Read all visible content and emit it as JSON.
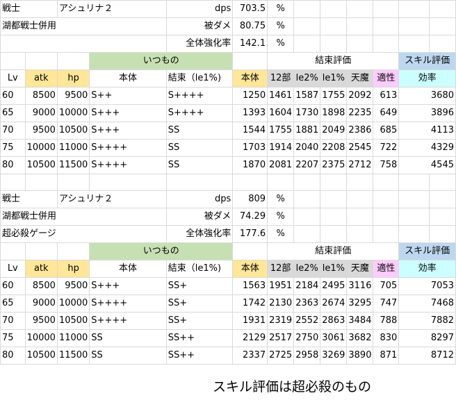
{
  "sections": [
    {
      "info": [
        {
          "a": "戦士",
          "b": "アシュリナ２",
          "label": "dps",
          "value": "703.5",
          "unit": "%"
        },
        {
          "a": "湖都戦士併用",
          "b": "",
          "label": "被ダメ",
          "value": "80.75",
          "unit": "%"
        },
        {
          "a": "",
          "b": "",
          "label": "全体強化率",
          "value": "142.1",
          "unit": "%"
        }
      ],
      "groups": {
        "itsumono": "いつもの",
        "kessoku": "結束評価",
        "skill": "スキル評価"
      },
      "headers": [
        "Lv",
        "atk",
        "hp",
        "本体",
        "結束（le1%)",
        "本体",
        "12部",
        "le2%",
        "le1%",
        "天魔",
        "適性",
        "効率"
      ],
      "rows": [
        [
          "60",
          "8500",
          "9500",
          "S++",
          "S++++",
          "1250",
          "1461",
          "1587",
          "1755",
          "2092",
          "613",
          "3680"
        ],
        [
          "65",
          "9000",
          "10000",
          "S+++",
          "S++++",
          "1393",
          "1604",
          "1730",
          "1898",
          "2235",
          "649",
          "3896"
        ],
        [
          "70",
          "9500",
          "10500",
          "S+++",
          "SS",
          "1544",
          "1755",
          "1881",
          "2049",
          "2386",
          "685",
          "4113"
        ],
        [
          "75",
          "10000",
          "11000",
          "S++++",
          "SS",
          "1703",
          "1914",
          "2040",
          "2208",
          "2545",
          "722",
          "4329"
        ],
        [
          "80",
          "10500",
          "11500",
          "S++++",
          "SS",
          "1870",
          "2081",
          "2207",
          "2375",
          "2712",
          "758",
          "4545"
        ]
      ]
    },
    {
      "info": [
        {
          "a": "戦士",
          "b": "アシュリナ２",
          "label": "dps",
          "value": "809",
          "unit": "%"
        },
        {
          "a": "湖都戦士併用",
          "b": "",
          "label": "被ダメ",
          "value": "74.29",
          "unit": "%"
        },
        {
          "a": "超必殺ゲージ",
          "b": "",
          "label": "全体強化率",
          "value": "177.6",
          "unit": "%"
        }
      ],
      "groups": {
        "itsumono": "いつもの",
        "kessoku": "結束評価",
        "skill": "スキル評価"
      },
      "headers": [
        "Lv",
        "atk",
        "hp",
        "本体",
        "結束（le1%)",
        "本体",
        "12部",
        "le2%",
        "le1%",
        "天魔",
        "適性",
        "効率"
      ],
      "rows": [
        [
          "60",
          "8500",
          "9500",
          "S+++",
          "SS+",
          "1563",
          "1951",
          "2184",
          "2495",
          "3116",
          "705",
          "7053"
        ],
        [
          "65",
          "9000",
          "10000",
          "S++++",
          "SS+",
          "1742",
          "2130",
          "2363",
          "2674",
          "3295",
          "747",
          "7468"
        ],
        [
          "70",
          "9500",
          "10500",
          "S++++",
          "SS+",
          "1931",
          "2319",
          "2552",
          "2863",
          "3484",
          "788",
          "7882"
        ],
        [
          "75",
          "10000",
          "11000",
          "SS",
          "SS++",
          "2129",
          "2517",
          "2750",
          "3061",
          "3682",
          "830",
          "8297"
        ],
        [
          "80",
          "10500",
          "11500",
          "SS",
          "SS++",
          "2337",
          "2725",
          "2958",
          "3269",
          "3890",
          "871",
          "8712"
        ]
      ]
    }
  ],
  "footnote": "スキル評価は超必殺のもの"
}
